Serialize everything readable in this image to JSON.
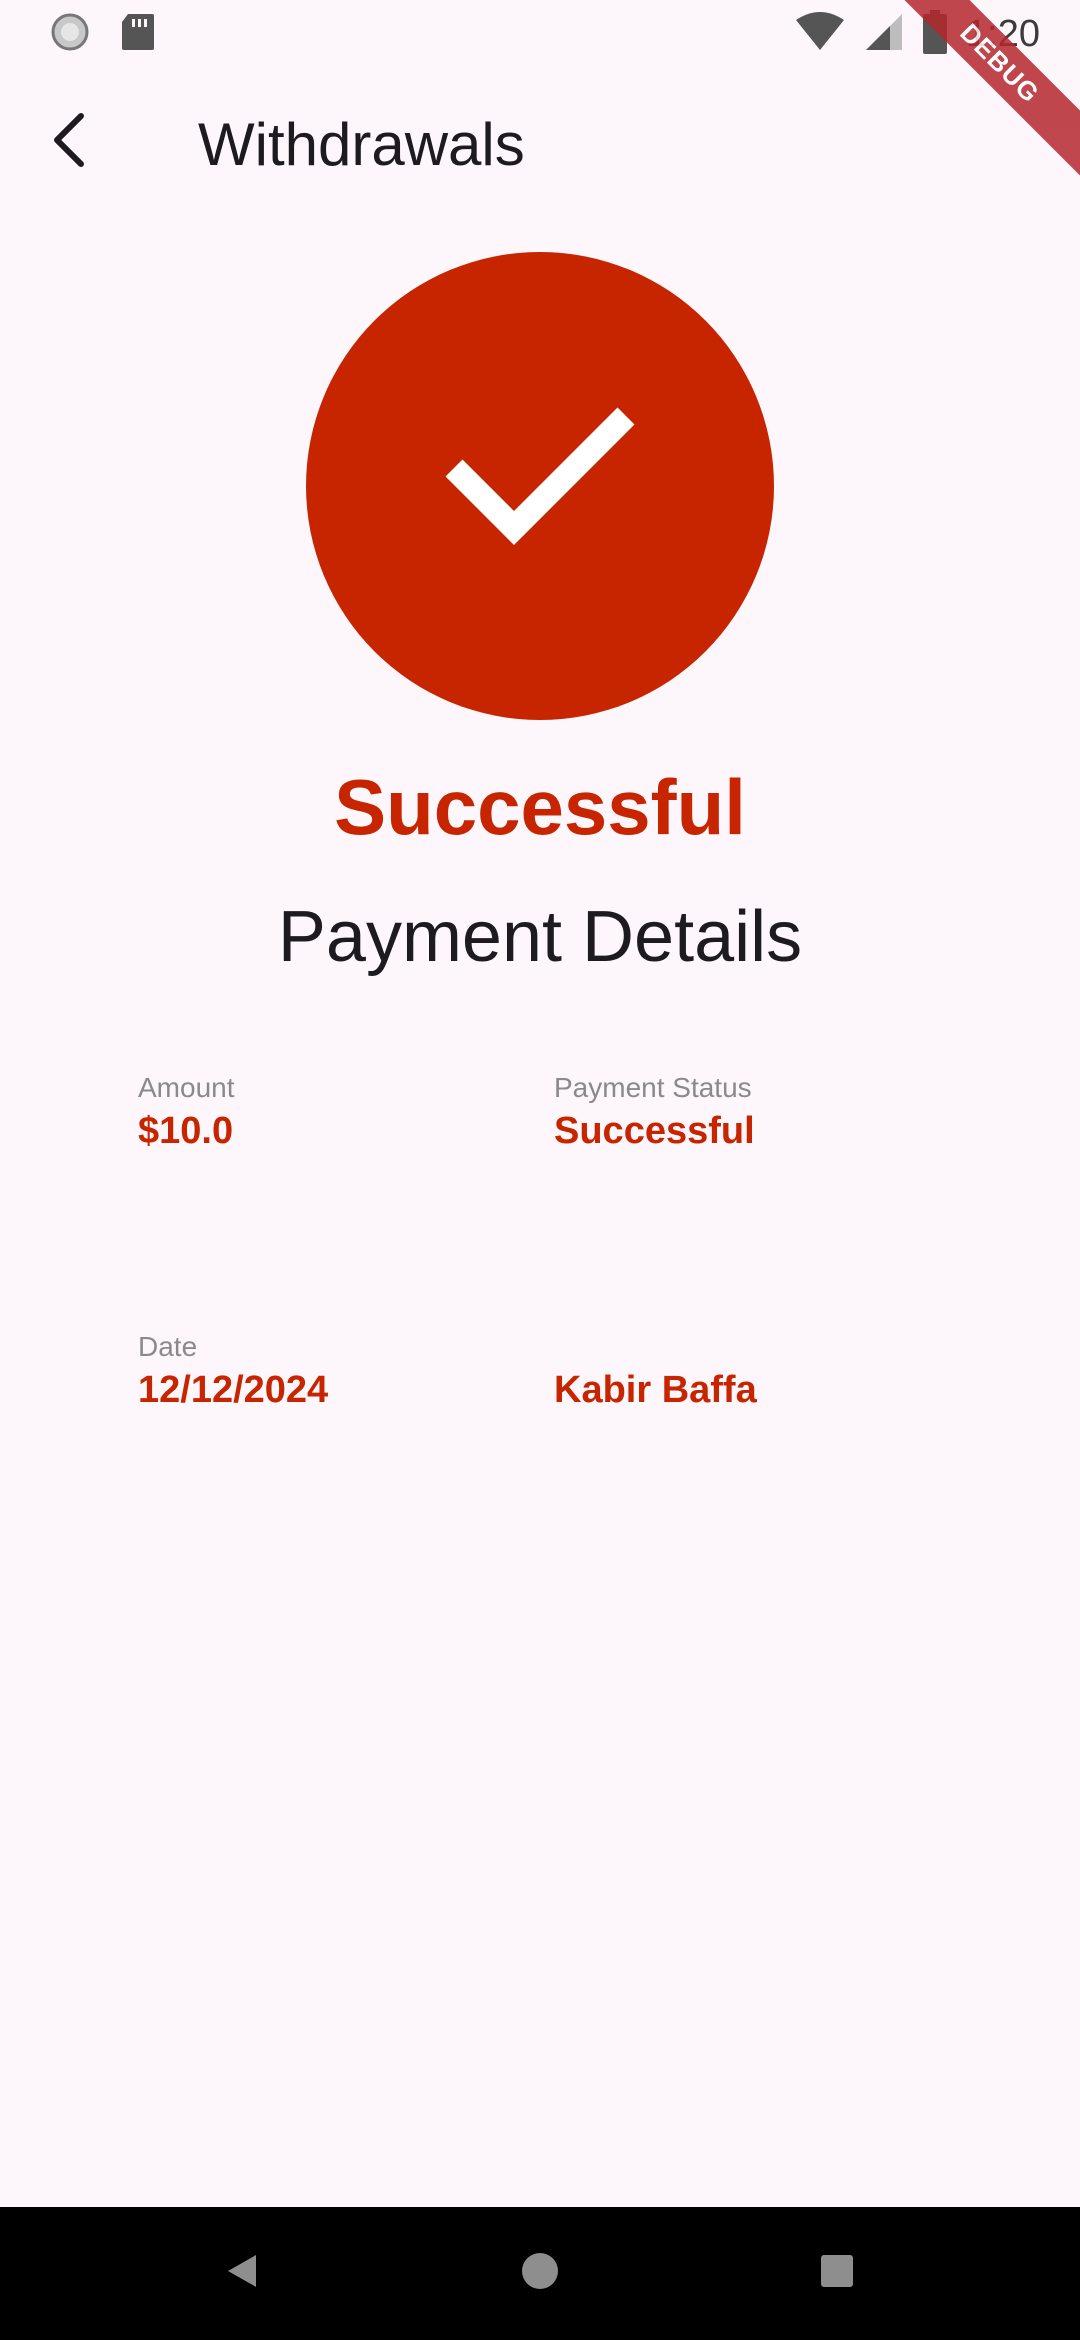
{
  "status_bar": {
    "time": "1:20",
    "left_icons": [
      "loading-circle-icon",
      "sd-card-icon"
    ],
    "right_icons": [
      "wifi-icon",
      "cellular-signal-icon",
      "battery-icon"
    ]
  },
  "debug_banner": "DEBUG",
  "app_bar": {
    "title": "Withdrawals",
    "back_icon": "back-arrow-icon"
  },
  "result": {
    "icon": "check-icon",
    "status": "Successful",
    "details_title": "Payment Details"
  },
  "details": {
    "amount_label": "Amount",
    "amount_value": "$10.0",
    "status_label": "Payment Status",
    "status_value": "Successful",
    "date_label": "Date",
    "date_value": "12/12/2024",
    "name_value": "Kabir Baffa"
  },
  "colors": {
    "accent": "#c72500",
    "background": "#fdf7fc",
    "text": "#1d1b20",
    "label": "#8a8a8a"
  },
  "nav_bar": {
    "icons": [
      "nav-back-icon",
      "nav-home-icon",
      "nav-recents-icon"
    ]
  }
}
